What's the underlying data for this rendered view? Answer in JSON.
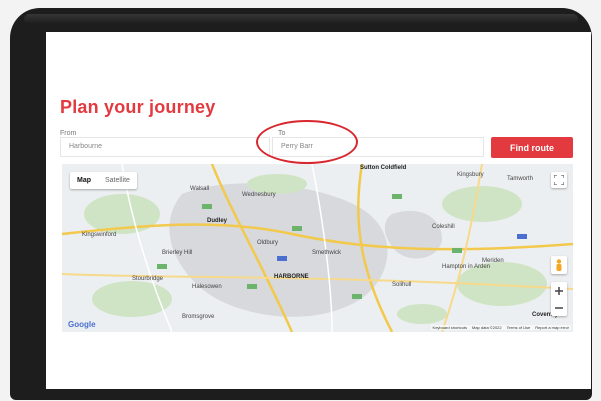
{
  "page": {
    "title": "Plan your journey"
  },
  "form": {
    "from_label": "From",
    "from_value": "Harbourne",
    "to_label": "To",
    "to_value": "Perry Barr",
    "find_button": "Find route"
  },
  "map": {
    "map_type": {
      "map": "Map",
      "satellite": "Satellite"
    },
    "places": [
      "Sutton Coldfield",
      "Dudley",
      "Walsall",
      "Wednesbury",
      "Kingsbury",
      "Tamworth",
      "Kingswinford",
      "Stourbridge",
      "Halesowen",
      "HARBORNE",
      "Solihull",
      "Coleshill",
      "Hampton in Arden",
      "Meriden",
      "Coventry",
      "Brierley Hill",
      "Oldbury",
      "Smethwick",
      "Bromsgrove"
    ],
    "attribution": [
      "Keyboard shortcuts",
      "Map data ©2022",
      "Terms of Use",
      "Report a map error"
    ],
    "google": "Google"
  }
}
